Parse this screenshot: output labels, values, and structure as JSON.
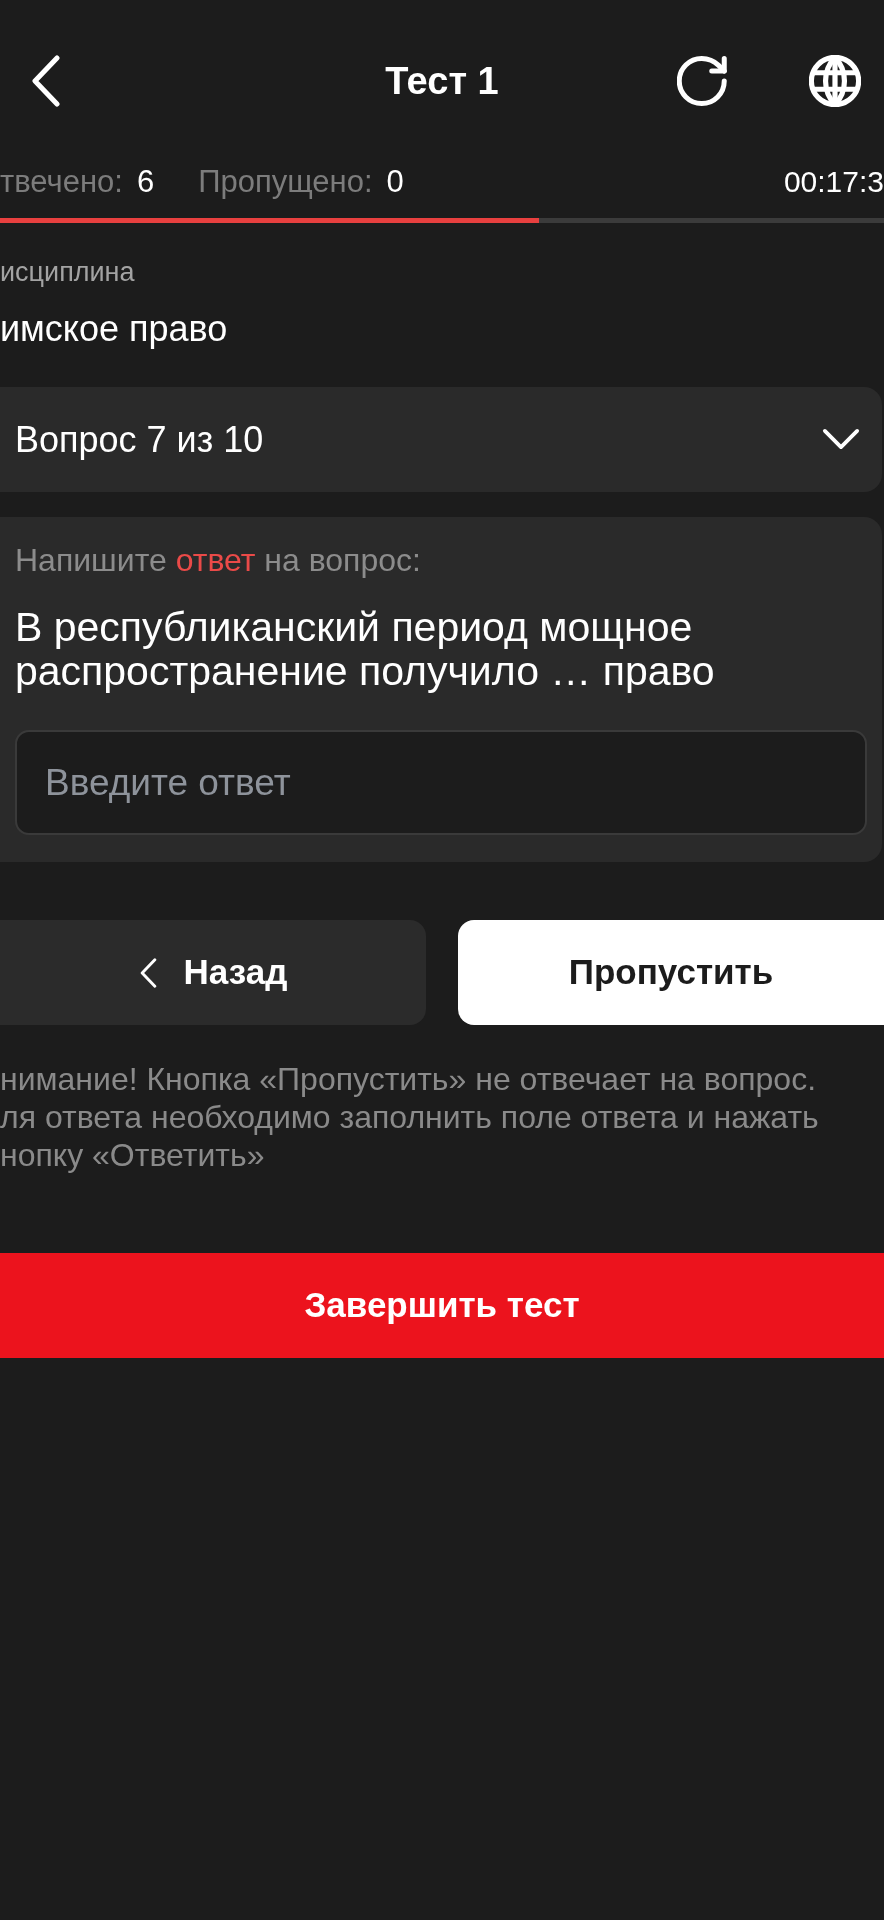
{
  "header": {
    "title": "Тест 1"
  },
  "stats": [
    {
      "label": "твечено:",
      "value": "6"
    },
    {
      "label": "Пропущено:",
      "value": "0"
    }
  ],
  "timer": "00:17:3",
  "progress": {
    "level": 0.61
  },
  "discipline": {
    "label": "исциплина",
    "value": "имское право"
  },
  "question_selector": {
    "label": "Вопрос 7 из 10",
    "expanded": false
  },
  "question": {
    "prompt_parts": [
      {
        "text": "Напишите",
        "highlighted": false
      },
      {
        "text": "ответ",
        "highlighted": true
      },
      {
        "text": "на вопрос:",
        "highlighted": false
      }
    ],
    "text": "В республиканский период мощное распространение получило … право",
    "answer_field": {
      "placeholder": "Введите ответ"
    }
  },
  "buttons": [
    {
      "kind": "back",
      "label": "Назад"
    },
    {
      "kind": "skip",
      "label": "Пропустить"
    }
  ],
  "notice_lines": [
    "нимание! Кнопка «Пропустить» не отвечает на вопрос.",
    "ля ответа необходимо заполнить поле ответа и нажать",
    "нопку «Ответить»"
  ],
  "finish_button": {
    "label": "Завершить тест"
  }
}
